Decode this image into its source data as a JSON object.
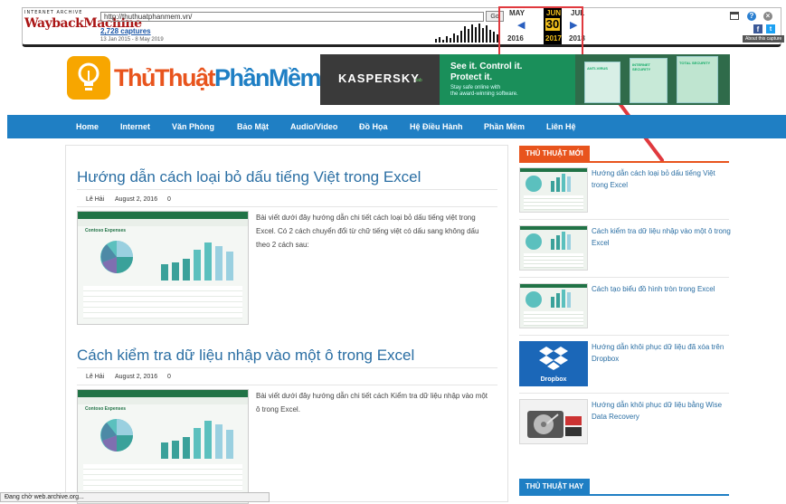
{
  "wayback": {
    "logo_top": "INTERNET ARCHIVE",
    "logo_main": "WaybackMachine",
    "url": "http://thuthuatphanmem.vn/",
    "go_label": "Go",
    "captures_count": "2,728 captures",
    "captures_range": "13 Jan 2015 - 8 May 2019",
    "calendar": {
      "prev_month": "MAY",
      "cur_month": "JUN",
      "next_month": "JUL",
      "day": "30",
      "prev_year": "2016",
      "cur_year": "2017",
      "next_year": "2018"
    },
    "about_label": "About this capture"
  },
  "site": {
    "logo_part1": "Thủ",
    "logo_part2": "Thuật",
    "logo_part3": "PhầnMềm",
    "colors": {
      "orange": "#e8541d",
      "blue": "#1f7fc4",
      "link": "#2a6ea3"
    }
  },
  "ad": {
    "brand": "KASPERSKY",
    "brand_suffix": "lab",
    "headline1": "See it. Control it.",
    "headline2": "Protect it.",
    "sub1": "Stay safe online with",
    "sub2": "the award-winning software.",
    "box1": "ANTI-VIRUS",
    "box2": "INTERNET SECURITY",
    "box3": "TOTAL SECURITY"
  },
  "nav": [
    "Home",
    "Internet",
    "Văn Phòng",
    "Bảo Mật",
    "Audio/Video",
    "Đồ Họa",
    "Hệ Điều Hành",
    "Phần Mềm",
    "Liên Hệ"
  ],
  "posts": [
    {
      "title": "Hướng dẫn cách loại bỏ dấu tiếng Việt trong Excel",
      "author": "Lê Hải",
      "date": "August 2, 2016",
      "comments": "0",
      "excerpt": "Bài viết dưới đây hướng dẫn chi tiết cách loại bỏ dấu tiếng việt trong Excel. Có 2 cách chuyển đổi từ chữ tiếng việt có dấu sang không dấu theo 2 cách sau:"
    },
    {
      "title": "Cách kiểm tra dữ liệu nhập vào một ô trong Excel",
      "author": "Lê Hải",
      "date": "August 2, 2016",
      "comments": "0",
      "excerpt": "Bài viết dưới đây hướng dẫn chi tiết cách Kiểm tra dữ liệu nhập vào một ô trong Excel."
    }
  ],
  "thumb_text": "Contoso Expenses",
  "sidebar": {
    "new_heading": "THỦ THUẬT MỚI",
    "new_items": [
      {
        "title": "Hướng dẫn cách loại bỏ dấu tiếng Việt trong Excel",
        "icon": "excel-thumb"
      },
      {
        "title": "Cách kiểm tra dữ liệu nhập vào một ô trong Excel",
        "icon": "excel-thumb"
      },
      {
        "title": "Cách tạo biểu đồ hình tròn trong Excel",
        "icon": "excel-thumb"
      },
      {
        "title": "Hướng dẫn khôi phục dữ liệu đã xóa trên Dropbox",
        "icon": "dropbox-thumb",
        "label": "Dropbox"
      },
      {
        "title": "Hướng dẫn khôi phục dữ liệu bằng Wise Data Recovery",
        "icon": "harddisk-thumb"
      }
    ],
    "hot_heading": "THỦ THUẬT HAY"
  },
  "status_text": "Đang chờ web.archive.org..."
}
